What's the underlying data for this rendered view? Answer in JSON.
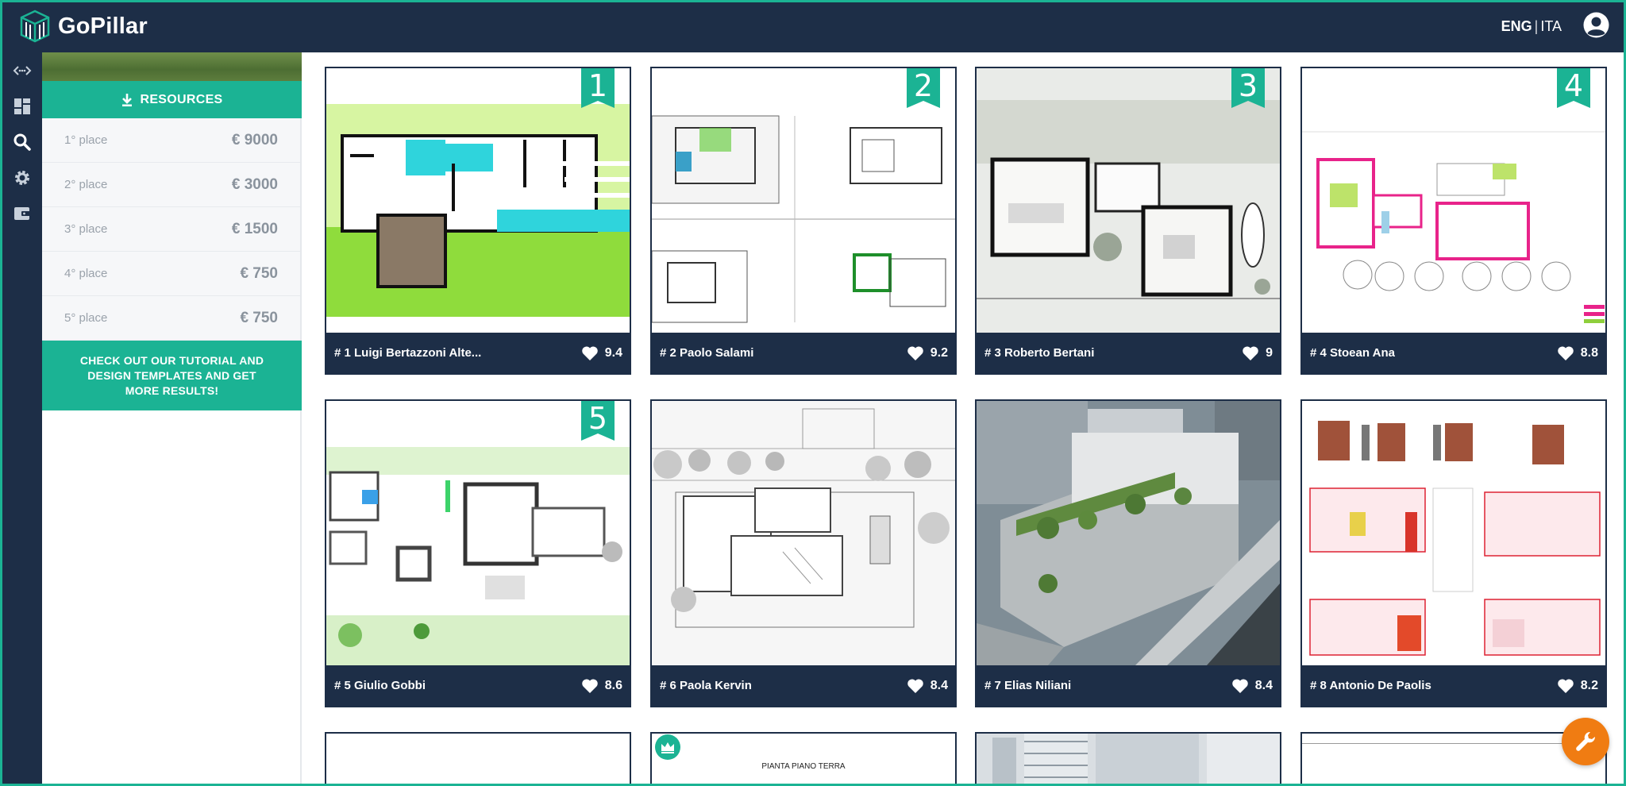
{
  "header": {
    "brand": "GoPillar",
    "lang_active": "ENG",
    "lang_separator": "|",
    "lang_other": "ITA"
  },
  "rail": [
    {
      "icon": "code-embed-icon"
    },
    {
      "icon": "dashboard-icon"
    },
    {
      "icon": "search-icon"
    },
    {
      "icon": "settings-gear-icon"
    },
    {
      "icon": "wallet-icon"
    }
  ],
  "sidebar": {
    "resources_label": "RESOURCES",
    "prizes": [
      {
        "place": "1° place",
        "amount": "€ 9000"
      },
      {
        "place": "2° place",
        "amount": "€ 3000"
      },
      {
        "place": "3° place",
        "amount": "€ 1500"
      },
      {
        "place": "4° place",
        "amount": "€ 750"
      },
      {
        "place": "5° place",
        "amount": "€ 750"
      }
    ],
    "tutorial_text": "CHECK OUT OUR TUTORIAL AND DESIGN TEMPLATES AND GET MORE RESULTS!"
  },
  "projects": [
    {
      "rank": "1",
      "name": "# 1 Luigi Bertazzoni Alte...",
      "score": "9.4"
    },
    {
      "rank": "2",
      "name": "# 2 Paolo Salami",
      "score": "9.2"
    },
    {
      "rank": "3",
      "name": "# 3 Roberto Bertani",
      "score": "9"
    },
    {
      "rank": "4",
      "name": "# 4 Stoean Ana",
      "score": "8.8"
    },
    {
      "rank": "5",
      "name": "# 5 Giulio Gobbi",
      "score": "8.6"
    },
    {
      "rank": "",
      "name": "# 6 Paola Kervin",
      "score": "8.4"
    },
    {
      "rank": "",
      "name": "# 7 Elias Niliani",
      "score": "8.4"
    },
    {
      "rank": "",
      "name": "# 8 Antonio De Paolis",
      "score": "8.2"
    }
  ],
  "partial_cards": {
    "card10_caption": "PIANTA PIANO TERRA"
  },
  "colors": {
    "navy": "#1d2e47",
    "teal": "#1bb394",
    "orange": "#f07c12"
  }
}
